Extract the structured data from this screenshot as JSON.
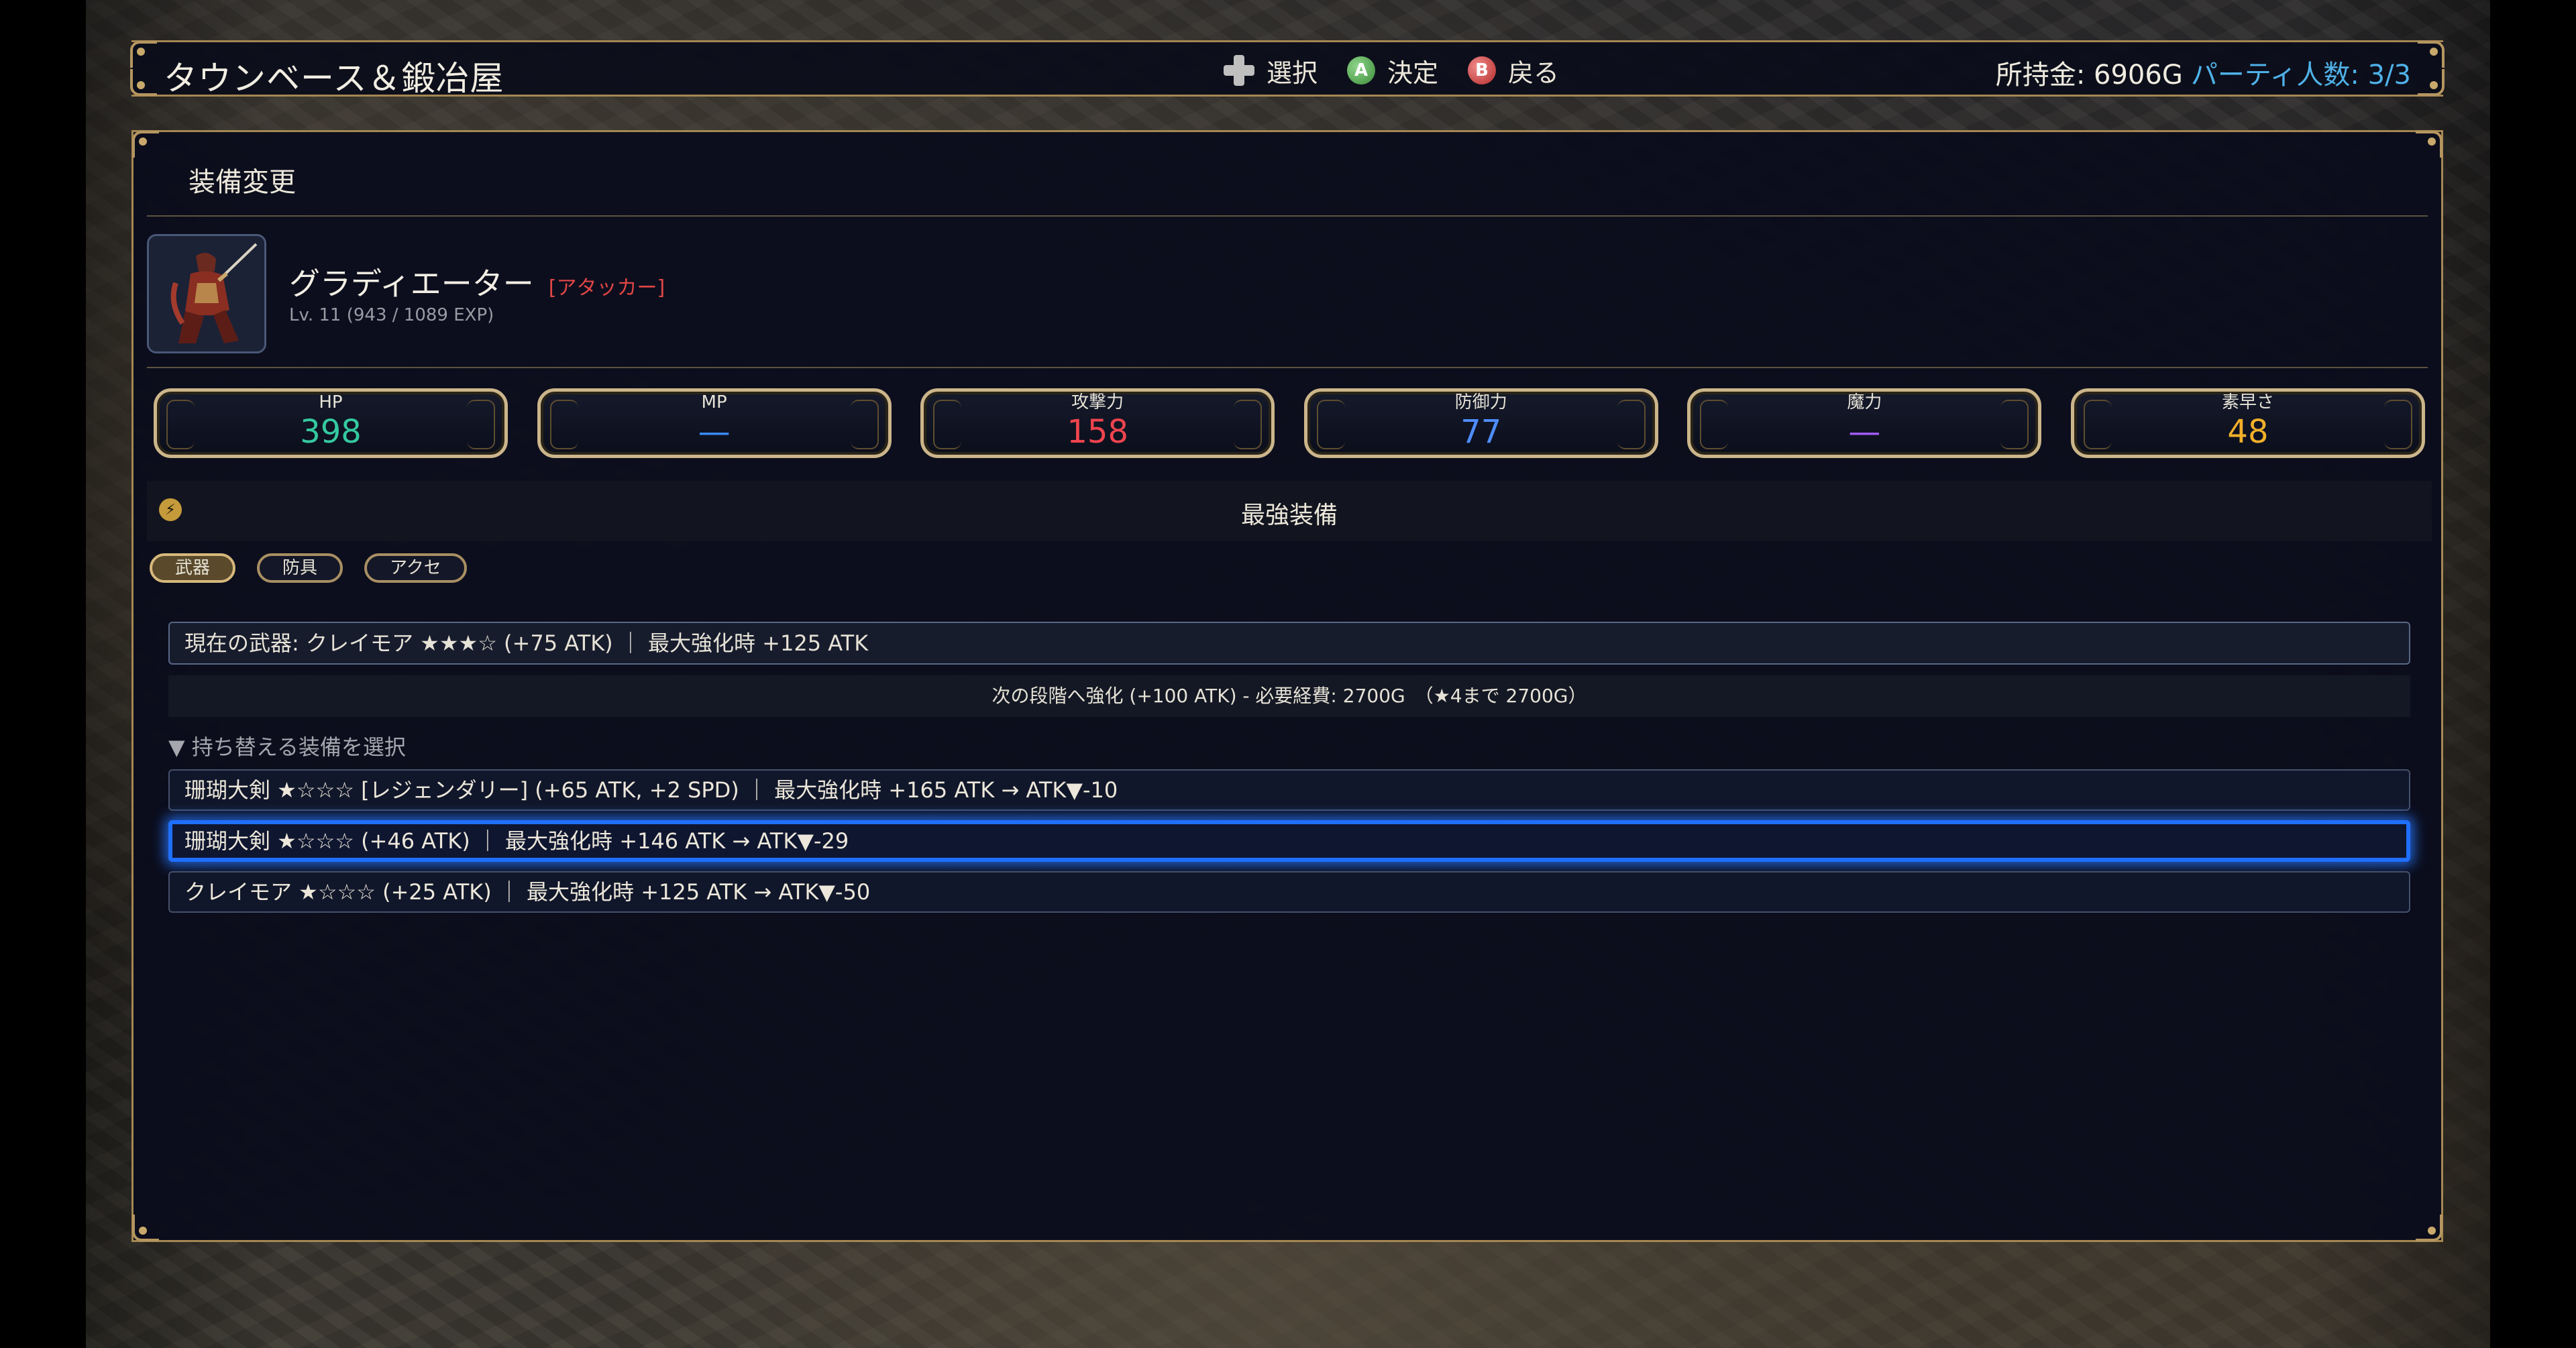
{
  "header": {
    "title": "タウンベース＆鍛冶屋",
    "controls": [
      {
        "icon": "dpad-icon",
        "label": "選択"
      },
      {
        "icon": "a-button-icon",
        "glyph": "A",
        "label": "決定"
      },
      {
        "icon": "b-button-icon",
        "glyph": "B",
        "label": "戻る"
      }
    ],
    "gold": "所持金: 6906G",
    "party": "パーティ人数: 3/3"
  },
  "panel": {
    "title": "装備変更"
  },
  "character": {
    "name": "グラディエーター",
    "role": "[アタッカー]",
    "level": "Lv. 11  (943 / 1089 EXP)"
  },
  "stats": [
    {
      "label": "HP",
      "value": "398",
      "color": "#35c9a0"
    },
    {
      "label": "MP",
      "value": "—",
      "color": "#3c8cff"
    },
    {
      "label": "攻撃力",
      "value": "158",
      "color": "#f0444e"
    },
    {
      "label": "防御力",
      "value": "77",
      "color": "#4f8dff"
    },
    {
      "label": "魔力",
      "value": "—",
      "color": "#a35cff"
    },
    {
      "label": "素早さ",
      "value": "48",
      "color": "#f2b02a"
    }
  ],
  "best_equip": {
    "icon": "lightning-icon",
    "icon_glyph": "⚡",
    "label": "最強装備"
  },
  "tabs": [
    "武器",
    "防具",
    "アクセ"
  ],
  "active_tab": "武器",
  "current_weapon": "現在の武器: クレイモア ★★★☆ (+75 ATK) ｜ 最大強化時 +125 ATK",
  "upgrade_info": "次の段階へ強化 (+100 ATK) - 必要経費: 2700G　（★4まで 2700G）",
  "list_header": "▼ 持ち替える装備を選択",
  "equipment": [
    {
      "text": "珊瑚大剣 ★☆☆☆ [レジェンダリー] (+65 ATK, +2 SPD) ｜ 最大強化時 +165 ATK → ATK▼-10",
      "selected": false
    },
    {
      "text": "珊瑚大剣 ★☆☆☆ (+46 ATK) ｜ 最大強化時 +146 ATK → ATK▼-29",
      "selected": true
    },
    {
      "text": "クレイモア ★☆☆☆ (+25 ATK) ｜ 最大強化時 +125 ATK → ATK▼-50",
      "selected": false
    }
  ]
}
